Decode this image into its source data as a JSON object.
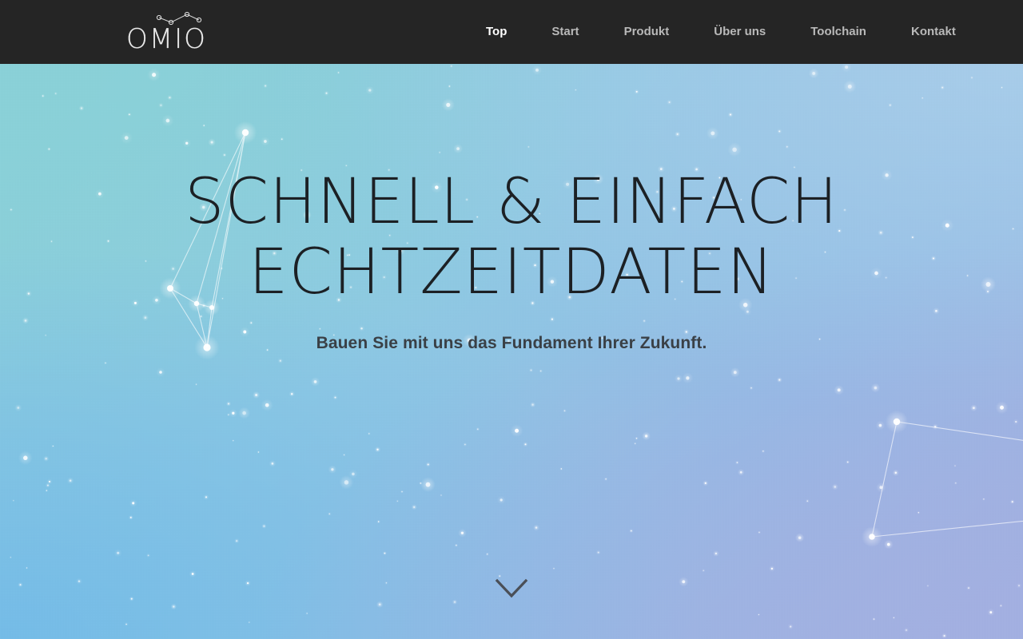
{
  "header": {
    "background_color": "#252525",
    "brand": {
      "wordmark": "OMIO",
      "mark_icon": "constellation-icon"
    },
    "nav": {
      "items": [
        {
          "label": "Top",
          "active": true
        },
        {
          "label": "Start",
          "active": false
        },
        {
          "label": "Produkt",
          "active": false
        },
        {
          "label": "Über uns",
          "active": false
        },
        {
          "label": "Toolchain",
          "active": false
        },
        {
          "label": "Kontakt",
          "active": false
        }
      ],
      "active_color": "#ffffff",
      "inactive_color": "#b9b9b9"
    }
  },
  "hero": {
    "title_line_1": "SCHNELL & EINFACH",
    "title_line_2": "ECHTZEITDATEN",
    "title_color": "#1c2024",
    "subtitle": "Bauen Sie mit uns das Fundament Ihrer Zukunft.",
    "subtitle_color": "#3a4046",
    "scroll_icon": "chevron-down-icon",
    "scroll_icon_color": "#4a4f57",
    "background": {
      "top_left_color": "#8ad1d8",
      "top_right_color": "#a8cdea",
      "bottom_left_color": "#74bce8",
      "bottom_right_color": "#a3b0e2",
      "decor_icon": "constellation-icon"
    }
  }
}
